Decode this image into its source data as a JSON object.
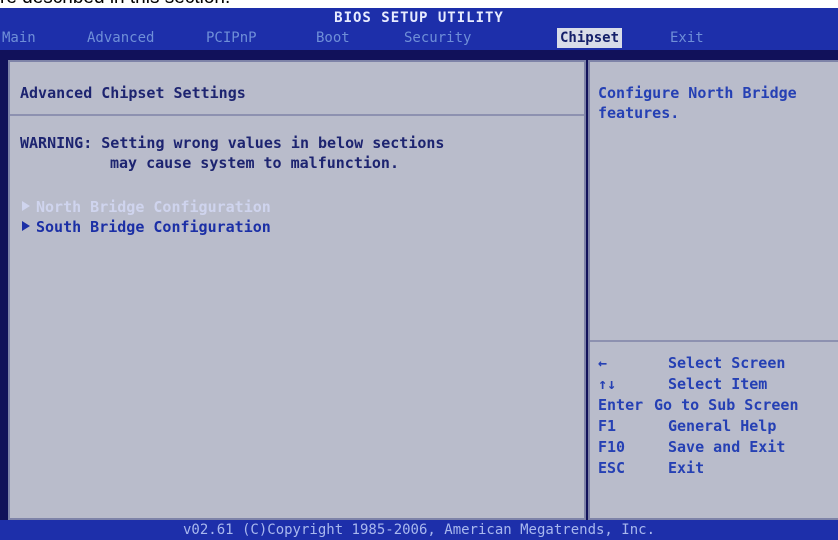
{
  "caption": "re described in this section.",
  "title": "BIOS SETUP UTILITY",
  "menu": {
    "items": [
      {
        "label": "Main"
      },
      {
        "label": "Advanced"
      },
      {
        "label": "PCIPnP"
      },
      {
        "label": "Boot"
      },
      {
        "label": "Security"
      },
      {
        "label": "Chipset"
      },
      {
        "label": "Exit"
      }
    ],
    "active": "Chipset"
  },
  "main": {
    "heading": "Advanced Chipset Settings",
    "warning_line1": "WARNING: Setting wrong values in below sections",
    "warning_line2": "may cause system to malfunction.",
    "entries": [
      {
        "label": "North Bridge Configuration"
      },
      {
        "label": "South Bridge Configuration"
      }
    ]
  },
  "help": {
    "line1": "Configure North Bridge",
    "line2": "features.",
    "keys": [
      {
        "key": "←",
        "desc": "Select Screen"
      },
      {
        "key": "↑↓",
        "desc": "Select Item"
      },
      {
        "key": "Enter",
        "desc": "Go to Sub Screen"
      },
      {
        "key": "F1",
        "desc": "General Help"
      },
      {
        "key": "F10",
        "desc": "Save and Exit"
      },
      {
        "key": "ESC",
        "desc": "Exit"
      }
    ]
  },
  "footer": "v02.61 (C)Copyright 1985-2006, American Megatrends, Inc.",
  "colors": {
    "background": "#11115a",
    "bar": "#1d2faa",
    "panel": "#b9bccb",
    "text_blue": "#2540b4"
  }
}
